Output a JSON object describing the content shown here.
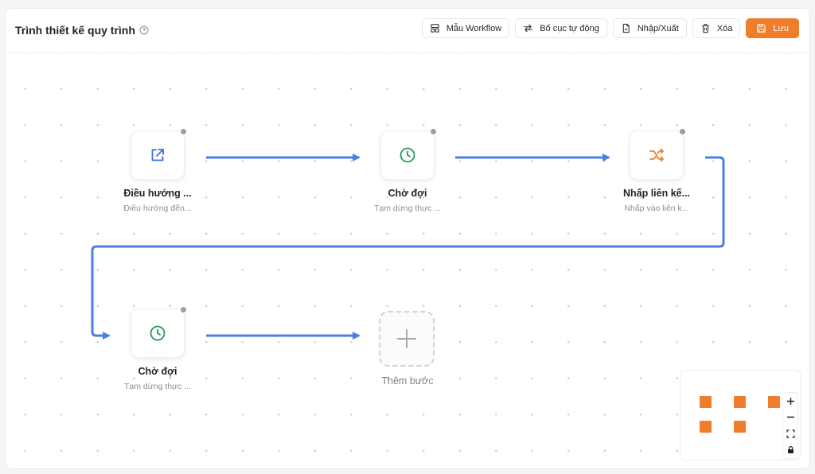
{
  "header": {
    "title": "Trình thiết kế quy trình",
    "buttons": {
      "templates": "Mẫu Workflow",
      "auto_layout": "Bố cục tự động",
      "import_export": "Nhập/Xuất",
      "delete": "Xóa",
      "save": "Lưu"
    }
  },
  "nodes": [
    {
      "icon": "external-link-icon",
      "label": "Điều hướng ...",
      "subtitle": "Điều hướng đến...",
      "color": "#3b6fe0"
    },
    {
      "icon": "clock-icon",
      "label": "Chờ đợi",
      "subtitle": "Tạm dừng thực ...",
      "color": "#1f9d55"
    },
    {
      "icon": "shuffle-icon",
      "label": "Nhấp liên kế...",
      "subtitle": "Nhấp vào liên k...",
      "color": "#ef7d2a"
    },
    {
      "icon": "clock-icon",
      "label": "Chờ đợi",
      "subtitle": "Tạm dừng thực ...",
      "color": "#1f9d55"
    }
  ],
  "add_step": {
    "label": "Thêm bước",
    "icon": "plus-icon"
  },
  "colors": {
    "accent": "#ef7d2a",
    "edge": "#4a7fe3",
    "grid_dot": "#c9ccd1"
  },
  "zoom_controls": [
    "zoom-in-icon",
    "zoom-out-icon",
    "fit-view-icon",
    "lock-icon"
  ]
}
